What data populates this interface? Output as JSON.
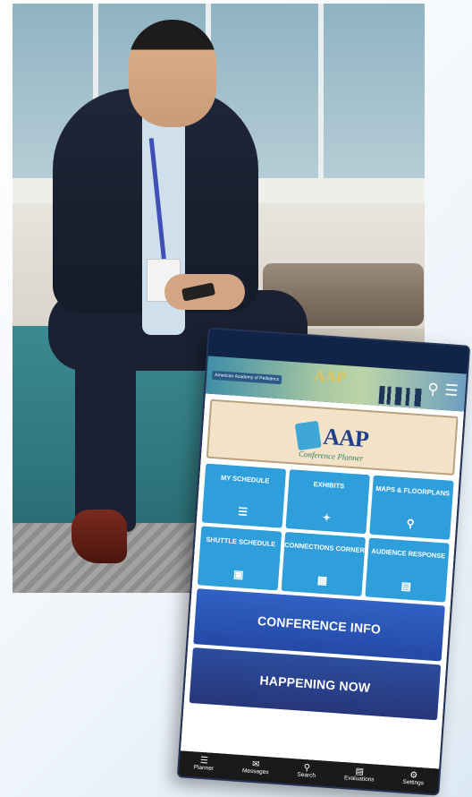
{
  "phone": {
    "banner": {
      "org_label": "American Academy of Pediatrics",
      "title": "AAP"
    },
    "logo": {
      "title": "AAP",
      "subtitle": "Conference Planner"
    },
    "tiles": [
      {
        "label": "MY SCHEDULE",
        "icon": "list-icon",
        "glyph": "☰"
      },
      {
        "label": "EXHIBITS",
        "icon": "handshake-icon",
        "glyph": "✦"
      },
      {
        "label": "MAPS & FLOORPLANS",
        "icon": "map-pin-icon",
        "glyph": "⚲"
      },
      {
        "label": "SHUTTLE SCHEDULE",
        "icon": "bus-icon",
        "glyph": "▣"
      },
      {
        "label": "CONNECTIONS CORNER",
        "icon": "building-icon",
        "glyph": "▦"
      },
      {
        "label": "AUDIENCE RESPONSE",
        "icon": "clipboard-icon",
        "glyph": "▤"
      }
    ],
    "conference_info": "CONFERENCE INFO",
    "happening_now": "HAPPENING NOW",
    "nav": [
      {
        "label": "Planner",
        "icon": "list-icon",
        "glyph": "☰"
      },
      {
        "label": "Messages",
        "icon": "chat-icon",
        "glyph": "✉"
      },
      {
        "label": "Search",
        "icon": "search-icon",
        "glyph": "⚲"
      },
      {
        "label": "Evaluations",
        "icon": "evaluations-icon",
        "glyph": "▤"
      },
      {
        "label": "Settings",
        "icon": "gear-icon",
        "glyph": "⚙"
      }
    ]
  }
}
